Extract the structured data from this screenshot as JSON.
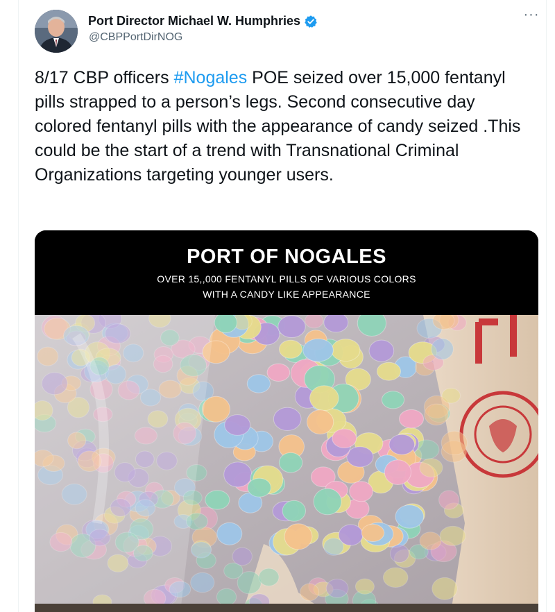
{
  "author": {
    "name": "Port Director Michael W. Humphries",
    "handle": "@CBPPortDirNOG",
    "verified": true
  },
  "menu": {
    "more_label": "···"
  },
  "tweet": {
    "text_before": "8/17 CBP officers ",
    "hashtag": "#Nogales",
    "text_after": " POE seized over 15,000 fentanyl pills strapped to a person’s legs. Second consecutive day colored fentanyl pills with the appearance of candy seized .This could be the start of a trend with Transnational Criminal Organizations targeting younger users."
  },
  "media": {
    "banner_title": "PORT OF NOGALES",
    "banner_sub_line1": "OVER 15,,000 FENTANYL PILLS OF VARIOUS COLORS",
    "banner_sub_line2": "WITH A CANDY LIKE APPEARANCE"
  },
  "colors": {
    "accent": "#1d9bf0",
    "text": "#0f1419",
    "secondary": "#536471",
    "pills": [
      "#b49ad8",
      "#f0a8c4",
      "#8fd4b8",
      "#f5c28c",
      "#e6dc8c",
      "#9ec6e8"
    ]
  }
}
